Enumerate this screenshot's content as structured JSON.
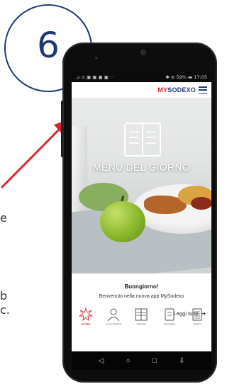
{
  "step": {
    "number": "6"
  },
  "edge_texts": [
    "e",
    "b",
    "c."
  ],
  "status_bar": {
    "left": "⊿ ⊙ ▣ ▣ ▣ ▣ ···",
    "right": "✱ ⊕ 59% ▬ 17:05"
  },
  "app": {
    "brand_prefix": "MY",
    "brand_suffix": "SODEXO"
  },
  "hero": {
    "title": "MENU DEL GIORNO"
  },
  "greeting": {
    "title": "Buongiorno!",
    "subtitle": "Benvenuto nella nuova app MySodexo"
  },
  "read_all": {
    "label": "Leggi tutte",
    "arrow": "➔"
  },
  "bottom_nav": [
    {
      "label": "HOME",
      "icon": "home-spark-icon"
    },
    {
      "label": "ACCOUNT",
      "icon": "person-icon"
    },
    {
      "label": "MENU",
      "icon": "menu-book-icon"
    },
    {
      "label": "DIARIO",
      "icon": "diary-icon"
    },
    {
      "label": "INFO",
      "icon": "info-list-icon"
    }
  ],
  "system_nav": {
    "back": "◁",
    "home": "○",
    "recents": "□",
    "more": "⇩"
  },
  "colors": {
    "accent_red": "#d8282f",
    "brand_blue": "#243c7a",
    "circle_blue": "#1f3a72"
  }
}
